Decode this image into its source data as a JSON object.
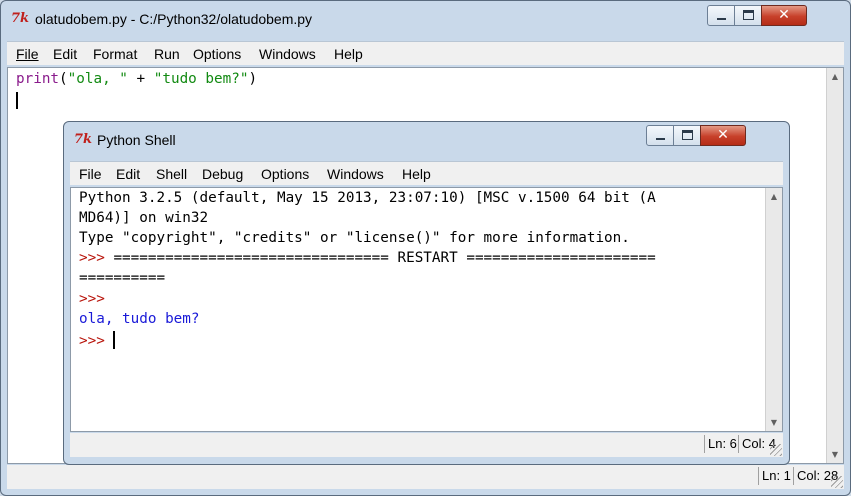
{
  "editor": {
    "title": "olatudobem.py - C:/Python32/olatudobem.py",
    "logo": "7k",
    "menu": [
      "File",
      "Edit",
      "Format",
      "Run",
      "Options",
      "Windows",
      "Help"
    ],
    "code": {
      "keyword": "print",
      "open": "(",
      "str1": "\"ola, \"",
      "plus": " + ",
      "str2": "\"tudo bem?\"",
      "close": ")"
    },
    "status": {
      "line": "Ln: 1",
      "col": "Col: 28"
    }
  },
  "shell": {
    "title": "Python Shell",
    "logo": "7k",
    "menu": [
      "File",
      "Edit",
      "Shell",
      "Debug",
      "Options",
      "Windows",
      "Help"
    ],
    "banner_line1": "Python 3.2.5 (default, May 15 2013, 23:07:10) [MSC v.1500 64 bit (A",
    "banner_line2": "MD64)] on win32",
    "banner_line3": "Type \"copyright\", \"credits\" or \"license()\" for more information.",
    "restart_prompt": ">>> ",
    "restart_text": "================================ RESTART ======================",
    "restart_cont": "==========",
    "prompt": ">>>",
    "output": "ola, tudo bem?",
    "prompt_last": ">>> ",
    "status": {
      "line": "Ln: 6",
      "col": "Col: 4"
    }
  },
  "icons": {
    "minimize": "minimize-icon",
    "maximize": "maximize-icon",
    "close": "close-icon",
    "close_glyph": "✕"
  },
  "colors": {
    "keyword": "#8a1b8c",
    "string": "#128a12",
    "prompt": "#b8140b",
    "stdout": "#1a1ad8",
    "close_button": "#c7402a"
  }
}
